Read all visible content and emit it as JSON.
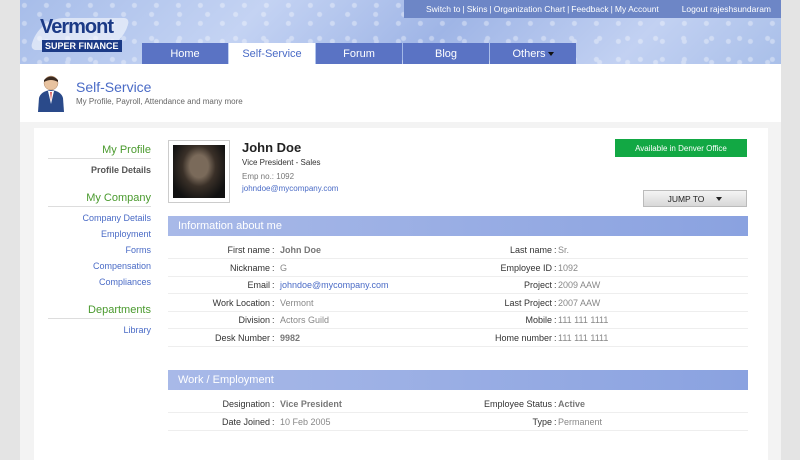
{
  "topbar": {
    "links": [
      "Switch to",
      "Skins",
      "Organization Chart",
      "Feedback",
      "My Account"
    ],
    "logout": "Logout rajeshsundaram"
  },
  "logo": {
    "line1": "Vermont",
    "line2": "SUPER FINANCE"
  },
  "nav": {
    "tabs": [
      {
        "label": "Home",
        "active": false
      },
      {
        "label": "Self-Service",
        "active": true
      },
      {
        "label": "Forum",
        "active": false
      },
      {
        "label": "Blog",
        "active": false
      },
      {
        "label": "Others",
        "active": false
      }
    ]
  },
  "page": {
    "title": "Self-Service",
    "subtitle": "My Profile, Payroll, Attendance and many more"
  },
  "sidebar": {
    "my_profile": {
      "title": "My Profile",
      "items": [
        "Profile Details"
      ]
    },
    "my_company": {
      "title": "My Company",
      "items": [
        "Company Details",
        "Employment",
        "Forms",
        "Compensation",
        "Compliances"
      ]
    },
    "departments": {
      "title": "Departments",
      "items": [
        "Library"
      ]
    }
  },
  "profile": {
    "name": "John Doe",
    "role": "Vice President  - Sales",
    "emp": "Emp no.: 1092",
    "email": "johndoe@mycompany.com",
    "status": "Available in Denver Office",
    "jump_to": "JUMP TO"
  },
  "info": {
    "header": "Information about me",
    "rows": [
      [
        "First name",
        "John Doe",
        "Last name",
        "Sr."
      ],
      [
        "Nickname",
        "G",
        "Employee ID",
        "1092"
      ],
      [
        "Email",
        "johndoe@mycompany.com",
        "Project",
        "2009 AAW"
      ],
      [
        "Work Location",
        "Vermont",
        "Last Project",
        "2007 AAW"
      ],
      [
        "Division",
        "Actors Guild",
        "Mobile",
        "111 111 1111"
      ],
      [
        "Desk Number",
        "9982",
        "Home number",
        "111 111 1111"
      ]
    ]
  },
  "work": {
    "header": "Work / Employment",
    "rows": [
      [
        "Designation",
        "Vice President",
        "Employee Status",
        "Active"
      ],
      [
        "Date Joined",
        "10 Feb 2005",
        "Type",
        "Permanent"
      ]
    ]
  },
  "colors": {
    "nav": "#5a73c4",
    "accent": "#4a6bc6",
    "status_green": "#12a844",
    "section_green": "#4a9a2e"
  }
}
